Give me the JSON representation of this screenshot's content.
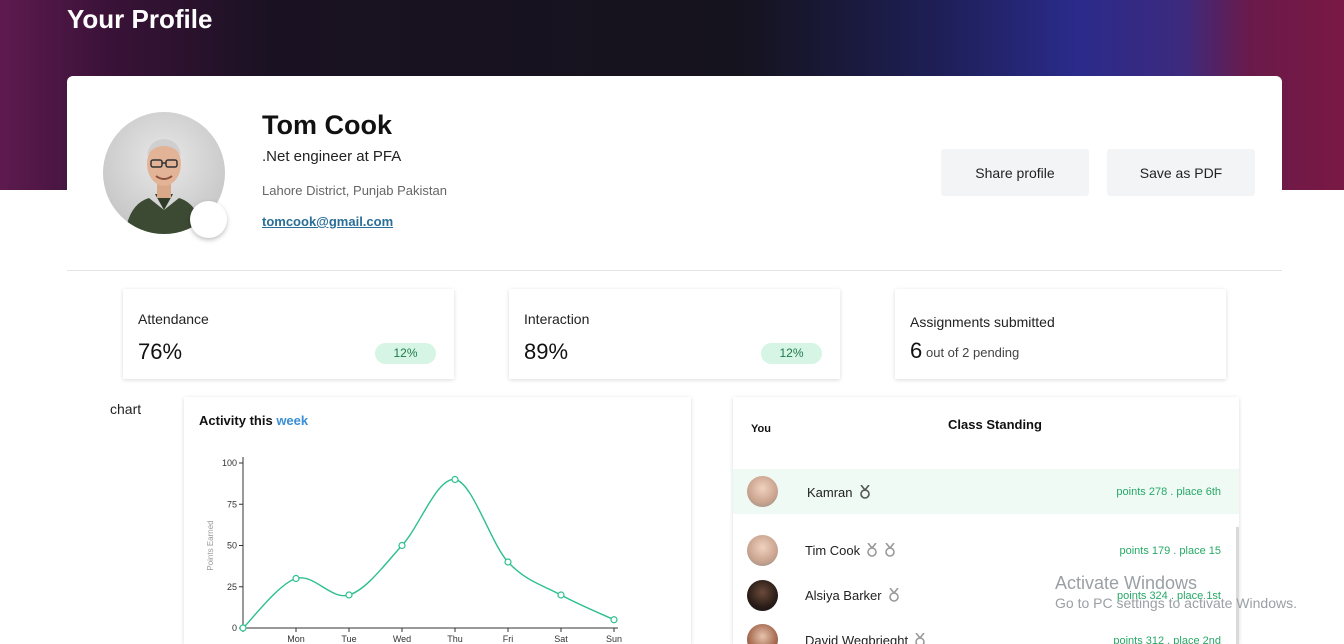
{
  "header": {
    "title": "Your Profile"
  },
  "profile": {
    "name": "Tom Cook",
    "role": ".Net engineer at PFA",
    "location": "Lahore District, Punjab Pakistan",
    "email": "tomcook@gmail.com",
    "share_label": "Share profile",
    "pdf_label": "Save as PDF"
  },
  "stats": [
    {
      "label": "Attendance",
      "value": "76%",
      "badge": "12%"
    },
    {
      "label": "Interaction",
      "value": "89%",
      "badge": "12%"
    },
    {
      "label": "Assignments submitted",
      "value": "6",
      "sub": "out of 2 pending"
    }
  ],
  "chart_section_label": "chart",
  "chart": {
    "title_prefix": "Activity this",
    "title_highlight": "week"
  },
  "chart_data": {
    "type": "line",
    "title": "Activity this week",
    "xlabel": "",
    "ylabel": "Points Earned",
    "categories": [
      "",
      "Mon",
      "Tue",
      "Wed",
      "Thu",
      "Fri",
      "Sat",
      "Sun"
    ],
    "values": [
      0,
      30,
      20,
      50,
      90,
      40,
      20,
      5
    ],
    "yticks": [
      0,
      25,
      50,
      75,
      100
    ],
    "ylim": [
      0,
      100
    ],
    "grid": false,
    "colors": {
      "line": "#2bbf8e"
    }
  },
  "standing": {
    "you_label": "You",
    "title": "Class Standing",
    "rows": [
      {
        "name": "Kamran",
        "points": "points 278 . place 6th",
        "medals": 1,
        "highlight": true
      },
      {
        "name": "Tim Cook",
        "points": "points 179 . place 15",
        "medals": 2
      },
      {
        "name": "Alsiya Barker",
        "points": "points 324 . place 1st",
        "medals": 1
      },
      {
        "name": "David Wegbrieght",
        "points": "points 312 . place 2nd",
        "medals": 1
      }
    ]
  },
  "watermark": {
    "title": "Activate Windows",
    "subtitle": "Go to PC settings to activate Windows."
  }
}
